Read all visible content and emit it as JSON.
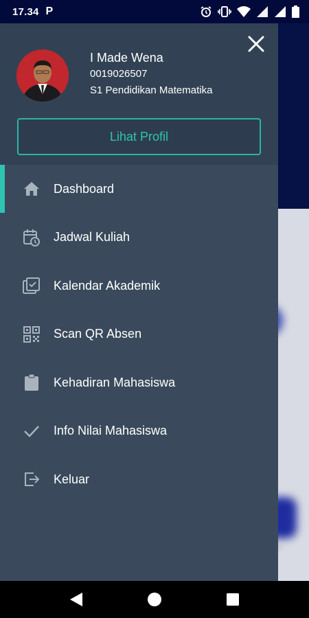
{
  "status_bar": {
    "time": "17.34",
    "notification": "P",
    "icons": [
      "alarm-icon",
      "vibrate-icon",
      "wifi-icon",
      "signal-icon",
      "signal-icon",
      "battery-icon"
    ]
  },
  "drawer": {
    "profile": {
      "name": "I Made Wena",
      "id": "0019026507",
      "program": "S1 Pendidikan Matematika"
    },
    "profile_button": "Lihat Profil",
    "menu": [
      {
        "label": "Dashboard",
        "icon": "home-icon",
        "active": true
      },
      {
        "label": "Jadwal Kuliah",
        "icon": "calendar-clock-icon",
        "active": false
      },
      {
        "label": "Kalendar Akademik",
        "icon": "calendar-check-icon",
        "active": false
      },
      {
        "label": "Scan QR Absen",
        "icon": "qr-code-icon",
        "active": false
      },
      {
        "label": "Kehadiran Mahasiswa",
        "icon": "clipboard-icon",
        "active": false
      },
      {
        "label": "Info Nilai Mahasiswa",
        "icon": "check-icon",
        "active": false
      },
      {
        "label": "Keluar",
        "icon": "logout-icon",
        "active": false
      }
    ]
  },
  "colors": {
    "drawer_bg": "#3a4a5c",
    "accent": "#2ec4b1",
    "status_bar": "#020a3c"
  },
  "nav_bar": {
    "buttons": [
      "back-icon",
      "home-circle-icon",
      "recents-icon"
    ]
  }
}
